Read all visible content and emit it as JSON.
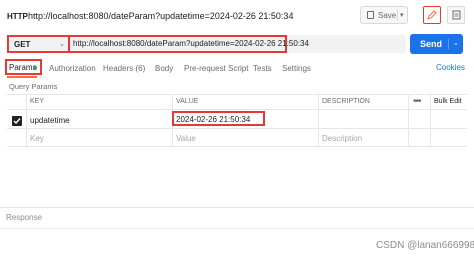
{
  "header": {
    "method_badge": "HTTP",
    "title": "http://localhost:8080/dateParam?updatetime=2024-02-26 21:50:34",
    "save_label": "Save"
  },
  "request": {
    "method": "GET",
    "url": "http://localhost:8080/dateParam?updatetime=2024-02-26 21:50:34",
    "send_label": "Send"
  },
  "tabs": [
    {
      "label": "Params"
    },
    {
      "label": "Authorization"
    },
    {
      "label": "Headers (6)"
    },
    {
      "label": "Body"
    },
    {
      "label": "Pre-request Script"
    },
    {
      "label": "Tests"
    },
    {
      "label": "Settings"
    }
  ],
  "cookies_label": "Cookies",
  "query_params": {
    "title": "Query Params",
    "columns": [
      "KEY",
      "VALUE",
      "DESCRIPTION"
    ],
    "bulk_edit_label": "Bulk Edit",
    "rows": [
      {
        "checked": true,
        "key": "updatetime",
        "value": "2024-02-26 21:50:34",
        "description": ""
      }
    ],
    "placeholder_key": "Key",
    "placeholder_value": "Value",
    "placeholder_description": "Description"
  },
  "response": {
    "label": "Response"
  },
  "watermark": "CSDN @lanan666998",
  "colors": {
    "accent": "#ff6c37",
    "highlight": "#e53935",
    "send": "#1a73e8",
    "badge_dot": "#26a65b"
  }
}
